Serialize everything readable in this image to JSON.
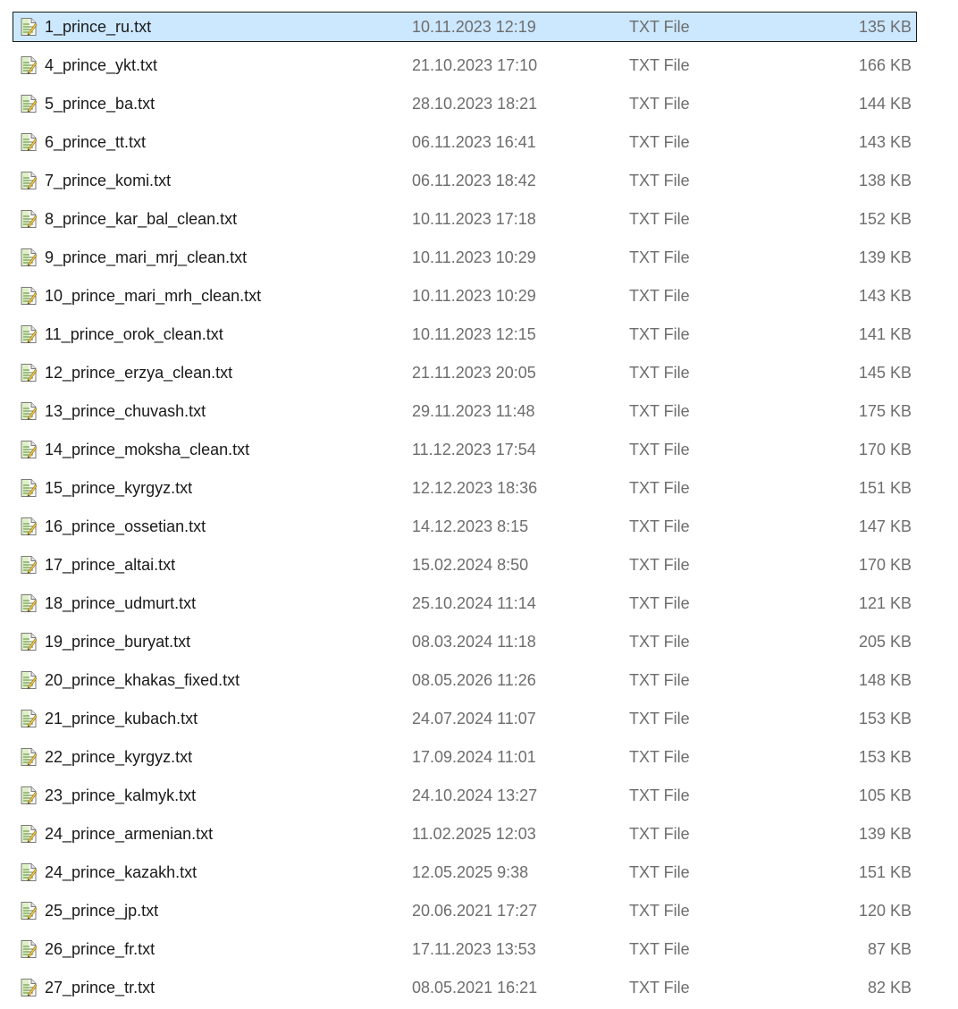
{
  "files": [
    {
      "name": "1_prince_ru.txt",
      "modified": "10.11.2023 12:19",
      "type": "TXT File",
      "size": "135 KB",
      "selected": true,
      "icon": "text-file-icon"
    },
    {
      "name": "4_prince_ykt.txt",
      "modified": "21.10.2023 17:10",
      "type": "TXT File",
      "size": "166 KB",
      "selected": false,
      "icon": "text-file-icon"
    },
    {
      "name": "5_prince_ba.txt",
      "modified": "28.10.2023 18:21",
      "type": "TXT File",
      "size": "144 KB",
      "selected": false,
      "icon": "text-file-icon"
    },
    {
      "name": "6_prince_tt.txt",
      "modified": "06.11.2023 16:41",
      "type": "TXT File",
      "size": "143 KB",
      "selected": false,
      "icon": "text-file-icon"
    },
    {
      "name": "7_prince_komi.txt",
      "modified": "06.11.2023 18:42",
      "type": "TXT File",
      "size": "138 KB",
      "selected": false,
      "icon": "text-file-icon"
    },
    {
      "name": "8_prince_kar_bal_clean.txt",
      "modified": "10.11.2023 17:18",
      "type": "TXT File",
      "size": "152 KB",
      "selected": false,
      "icon": "text-file-icon"
    },
    {
      "name": "9_prince_mari_mrj_clean.txt",
      "modified": "10.11.2023 10:29",
      "type": "TXT File",
      "size": "139 KB",
      "selected": false,
      "icon": "text-file-icon"
    },
    {
      "name": "10_prince_mari_mrh_clean.txt",
      "modified": "10.11.2023 10:29",
      "type": "TXT File",
      "size": "143 KB",
      "selected": false,
      "icon": "text-file-icon"
    },
    {
      "name": "11_prince_orok_clean.txt",
      "modified": "10.11.2023 12:15",
      "type": "TXT File",
      "size": "141 KB",
      "selected": false,
      "icon": "text-file-icon"
    },
    {
      "name": "12_prince_erzya_clean.txt",
      "modified": "21.11.2023 20:05",
      "type": "TXT File",
      "size": "145 KB",
      "selected": false,
      "icon": "text-file-icon"
    },
    {
      "name": "13_prince_chuvash.txt",
      "modified": "29.11.2023 11:48",
      "type": "TXT File",
      "size": "175 KB",
      "selected": false,
      "icon": "text-file-icon"
    },
    {
      "name": "14_prince_moksha_clean.txt",
      "modified": "11.12.2023 17:54",
      "type": "TXT File",
      "size": "170 KB",
      "selected": false,
      "icon": "text-file-icon"
    },
    {
      "name": "15_prince_kyrgyz.txt",
      "modified": "12.12.2023 18:36",
      "type": "TXT File",
      "size": "151 KB",
      "selected": false,
      "icon": "text-file-icon"
    },
    {
      "name": "16_prince_ossetian.txt",
      "modified": "14.12.2023 8:15",
      "type": "TXT File",
      "size": "147 KB",
      "selected": false,
      "icon": "text-file-icon"
    },
    {
      "name": "17_prince_altai.txt",
      "modified": "15.02.2024 8:50",
      "type": "TXT File",
      "size": "170 KB",
      "selected": false,
      "icon": "text-file-icon"
    },
    {
      "name": "18_prince_udmurt.txt",
      "modified": "25.10.2024 11:14",
      "type": "TXT File",
      "size": "121 KB",
      "selected": false,
      "icon": "text-file-icon"
    },
    {
      "name": "19_prince_buryat.txt",
      "modified": "08.03.2024 11:18",
      "type": "TXT File",
      "size": "205 KB",
      "selected": false,
      "icon": "text-file-icon"
    },
    {
      "name": "20_prince_khakas_fixed.txt",
      "modified": "08.05.2026 11:26",
      "type": "TXT File",
      "size": "148 KB",
      "selected": false,
      "icon": "text-file-icon"
    },
    {
      "name": "21_prince_kubach.txt",
      "modified": "24.07.2024 11:07",
      "type": "TXT File",
      "size": "153 KB",
      "selected": false,
      "icon": "text-file-icon"
    },
    {
      "name": "22_prince_kyrgyz.txt",
      "modified": "17.09.2024 11:01",
      "type": "TXT File",
      "size": "153 KB",
      "selected": false,
      "icon": "text-file-icon"
    },
    {
      "name": "23_prince_kalmyk.txt",
      "modified": "24.10.2024 13:27",
      "type": "TXT File",
      "size": "105 KB",
      "selected": false,
      "icon": "text-file-icon"
    },
    {
      "name": "24_prince_armenian.txt",
      "modified": "11.02.2025 12:03",
      "type": "TXT File",
      "size": "139 KB",
      "selected": false,
      "icon": "text-file-icon"
    },
    {
      "name": "24_prince_kazakh.txt",
      "modified": "12.05.2025 9:38",
      "type": "TXT File",
      "size": "151 KB",
      "selected": false,
      "icon": "text-file-icon"
    },
    {
      "name": "25_prince_jp.txt",
      "modified": "20.06.2021 17:27",
      "type": "TXT File",
      "size": "120 KB",
      "selected": false,
      "icon": "text-file-icon"
    },
    {
      "name": "26_prince_fr.txt",
      "modified": "17.11.2023 13:53",
      "type": "TXT File",
      "size": "87 KB",
      "selected": false,
      "icon": "text-file-icon"
    },
    {
      "name": "27_prince_tr.txt",
      "modified": "08.05.2021 16:21",
      "type": "TXT File",
      "size": "82 KB",
      "selected": false,
      "icon": "text-file-icon"
    }
  ],
  "colors": {
    "selection_background": "#cce8ff",
    "selection_border": "#1a1a1a",
    "name_text": "#1a1a1a",
    "detail_text": "#6d6d6d"
  }
}
